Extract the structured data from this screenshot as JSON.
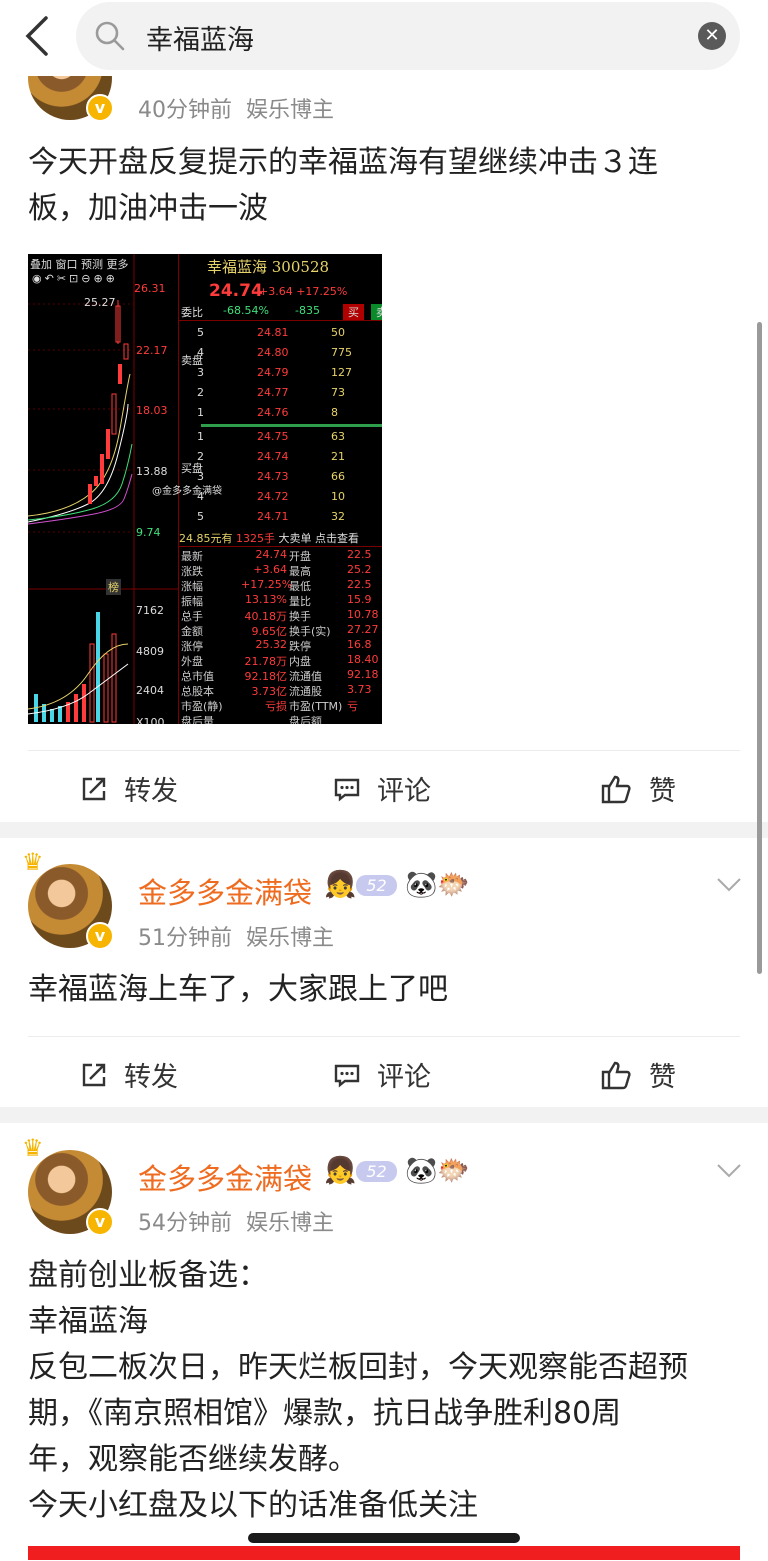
{
  "search": {
    "query": "幸福蓝海"
  },
  "posts": [
    {
      "time": "40分钟前",
      "category": "娱乐博主",
      "text_lines": [
        "今天开盘反复提示的幸福蓝海有望继续冲击３连",
        "板，加油冲击一波"
      ],
      "actions": {
        "repost": "转发",
        "comment": "评论",
        "like": "赞"
      }
    },
    {
      "author": "金多多金满袋",
      "level_badge": "52",
      "time": "51分钟前",
      "category": "娱乐博主",
      "text_lines": [
        "幸福蓝海上车了，大家跟上了吧"
      ],
      "actions": {
        "repost": "转发",
        "comment": "评论",
        "like": "赞"
      }
    },
    {
      "author": "金多多金满袋",
      "level_badge": "52",
      "time": "54分钟前",
      "category": "娱乐博主",
      "text_lines": [
        "盘前创业板备选：",
        "幸福蓝海",
        "反包二板次日，昨天烂板回封，今天观察能否超预",
        "期，《南京照相馆》爆款，抗日战争胜利80周",
        "年，观察能否继续发酵。",
        "今天小红盘及以下的话准备低关注"
      ]
    }
  ],
  "stock_image": {
    "menu": [
      "叠加",
      "窗口",
      "预测",
      "更多"
    ],
    "title": "幸福蓝海 300528",
    "price": "24.74",
    "change": "+3.64 +17.25%",
    "weibi_label": "委比",
    "weibi": "-68.54%",
    "weicha": "-835",
    "buy": "买",
    "sell": "卖",
    "axis": [
      "26.31",
      "22.17",
      "18.03",
      "13.88",
      "9.74"
    ],
    "vol_axis": [
      "7162",
      "4809",
      "2404",
      "X100"
    ],
    "hi_label": "25.27",
    "sell_label": "卖盘",
    "buy_label": "买盘",
    "sells": [
      {
        "lvl": "5",
        "price": "24.81",
        "qty": "50"
      },
      {
        "lvl": "4",
        "price": "24.80",
        "qty": "775"
      },
      {
        "lvl": "3",
        "price": "24.79",
        "qty": "127"
      },
      {
        "lvl": "2",
        "price": "24.77",
        "qty": "73"
      },
      {
        "lvl": "1",
        "price": "24.76",
        "qty": "8"
      }
    ],
    "buys": [
      {
        "lvl": "1",
        "price": "24.75",
        "qty": "63"
      },
      {
        "lvl": "2",
        "price": "24.74",
        "qty": "21"
      },
      {
        "lvl": "3",
        "price": "24.73",
        "qty": "66"
      },
      {
        "lvl": "4",
        "price": "24.72",
        "qty": "10"
      },
      {
        "lvl": "5",
        "price": "24.71",
        "qty": "32"
      }
    ],
    "big_order": [
      "24.85元有",
      "1325手",
      "大卖单",
      "点击查看"
    ],
    "quotes": [
      {
        "k1": "最新",
        "v1": "24.74",
        "k2": "开盘",
        "v2": "22.5"
      },
      {
        "k1": "涨跌",
        "v1": "+3.64",
        "k2": "最高",
        "v2": "25.2"
      },
      {
        "k1": "涨幅",
        "v1": "+17.25%",
        "k2": "最低",
        "v2": "22.5"
      },
      {
        "k1": "振幅",
        "v1": "13.13%",
        "k2": "量比",
        "v2": "15.9"
      },
      {
        "k1": "总手",
        "v1": "40.18万",
        "k2": "换手",
        "v2": "10.78"
      },
      {
        "k1": "金额",
        "v1": "9.65亿",
        "k2": "换手(实)",
        "v2": "27.27"
      },
      {
        "k1": "涨停",
        "v1": "25.32",
        "k2": "跌停",
        "v2": "16.8"
      },
      {
        "k1": "外盘",
        "v1": "21.78万",
        "k2": "内盘",
        "v2": "18.40"
      },
      {
        "k1": "总市值",
        "v1": "92.18亿",
        "k2": "流通值",
        "v2": "92.18"
      },
      {
        "k1": "总股本",
        "v1": "3.73亿",
        "k2": "流通股",
        "v2": "3.73"
      },
      {
        "k1": "市盈(静)",
        "v1": "亏损",
        "k2": "市盈(TTM)",
        "v2": "亏"
      },
      {
        "k1": "盘后量",
        "v1": "",
        "k2": "盘后额",
        "v2": ""
      }
    ],
    "watermark": "@金多多金满袋",
    "bang": "榜"
  }
}
